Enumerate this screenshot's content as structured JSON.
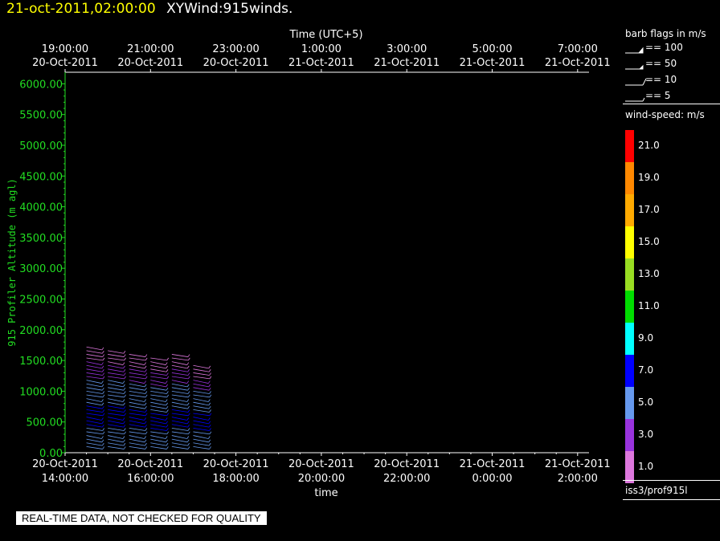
{
  "header": {
    "date": "21-oct-2011,02:00:00",
    "product": "XYWind:915winds."
  },
  "top_axis": {
    "title": "Time (UTC+5)",
    "ticks": [
      {
        "time": "19:00:00",
        "date": "20-Oct-2011"
      },
      {
        "time": "21:00:00",
        "date": "20-Oct-2011"
      },
      {
        "time": "23:00:00",
        "date": "20-Oct-2011"
      },
      {
        "time": "1:00:00",
        "date": "21-Oct-2011"
      },
      {
        "time": "3:00:00",
        "date": "21-Oct-2011"
      },
      {
        "time": "5:00:00",
        "date": "21-Oct-2011"
      },
      {
        "time": "7:00:00",
        "date": "21-Oct-2011"
      }
    ]
  },
  "bottom_axis": {
    "title": "time",
    "ticks": [
      {
        "date": "20-Oct-2011",
        "time": "14:00:00"
      },
      {
        "date": "20-Oct-2011",
        "time": "16:00:00"
      },
      {
        "date": "20-Oct-2011",
        "time": "18:00:00"
      },
      {
        "date": "20-Oct-2011",
        "time": "20:00:00"
      },
      {
        "date": "20-Oct-2011",
        "time": "22:00:00"
      },
      {
        "date": "21-Oct-2011",
        "time": "0:00:00"
      },
      {
        "date": "21-Oct-2011",
        "time": "2:00:00"
      }
    ]
  },
  "y_axis": {
    "title": "915 Profiler Altitude (m agl)",
    "ticks": [
      "0.00",
      "500.00",
      "1000.00",
      "1500.00",
      "2000.00",
      "2500.00",
      "3000.00",
      "3500.00",
      "4000.00",
      "4500.00",
      "5000.00",
      "5500.00",
      "6000.00"
    ],
    "color": "#22dd22"
  },
  "barb_legend": {
    "title": "barb flags in m/s",
    "items": [
      "== 100",
      "== 50",
      "== 10",
      "== 5"
    ]
  },
  "colorbar": {
    "title": "wind-speed: m/s",
    "labels": [
      "21.0",
      "19.0",
      "17.0",
      "15.0",
      "13.0",
      "11.0",
      "9.0",
      "7.0",
      "5.0",
      "3.0",
      "1.0"
    ],
    "colors": [
      "#ff0000",
      "#ff8800",
      "#ffaa00",
      "#ffff00",
      "#99dd22",
      "#00dd00",
      "#00ffff",
      "#0000ff",
      "#6699ee",
      "#9933dd",
      "#dd77dd"
    ]
  },
  "station": "iss3/prof915l",
  "warning": "REAL-TIME DATA, NOT CHECKED FOR QUALITY",
  "chart_data": {
    "type": "scatter",
    "description_type": "wind-barb time-height plot",
    "x_range_hours": [
      "2011-10-20 14:00",
      "2011-10-21 02:00"
    ],
    "ylim": [
      0,
      6200
    ],
    "series": [
      {
        "time": "2011-10-20 14:30",
        "max_alt": 1750
      },
      {
        "time": "2011-10-20 15:00",
        "max_alt": 1700
      },
      {
        "time": "2011-10-20 15:30",
        "max_alt": 1650
      },
      {
        "time": "2011-10-20 16:00",
        "max_alt": 1550
      },
      {
        "time": "2011-10-20 16:30",
        "max_alt": 1600
      },
      {
        "time": "2011-10-20 17:00",
        "max_alt": 1450
      }
    ]
  }
}
